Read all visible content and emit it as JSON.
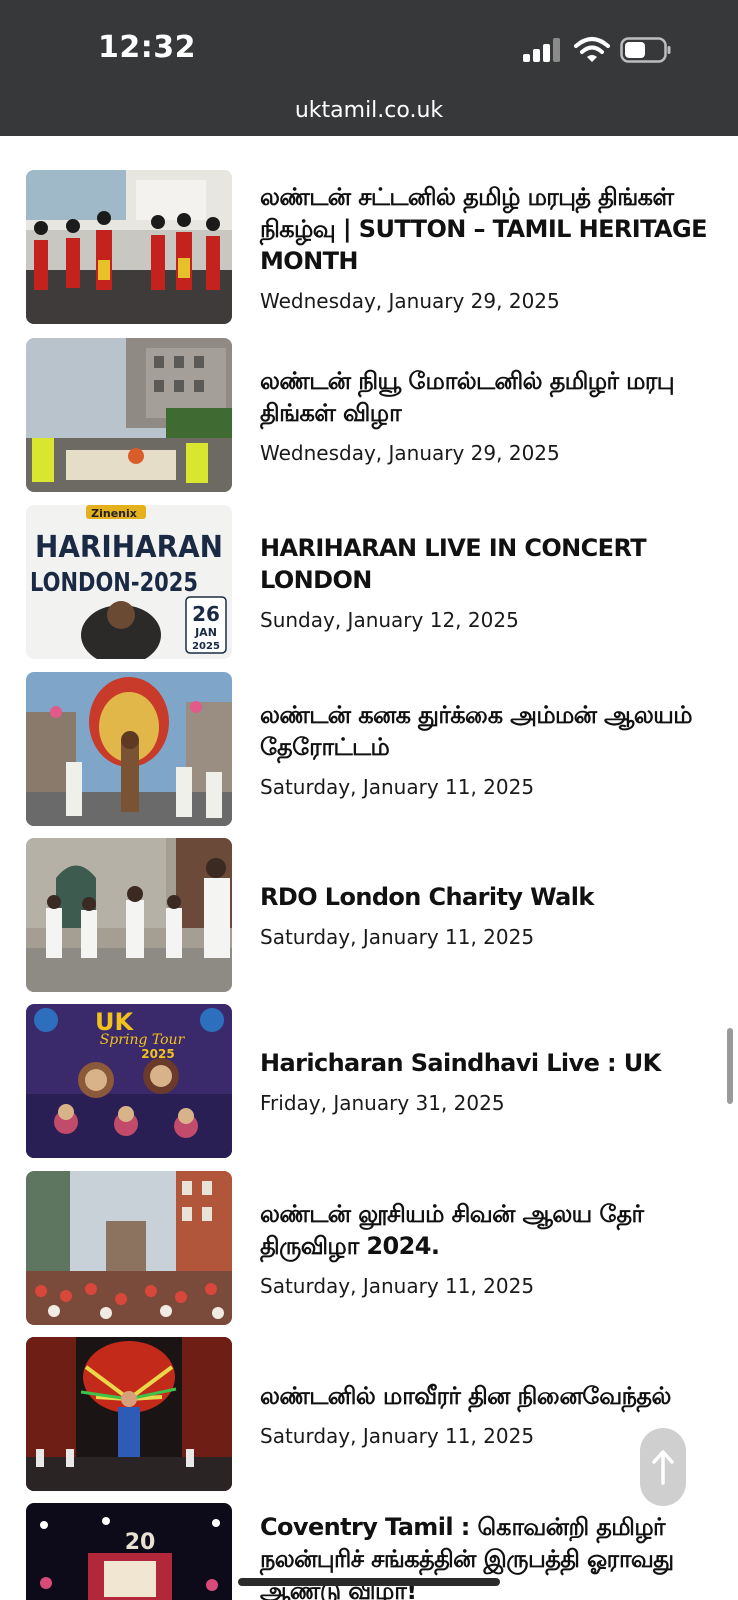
{
  "status_bar": {
    "time": "12:32",
    "url": "uktamil.co.uk",
    "icons": [
      "signal-icon",
      "wifi-icon",
      "battery-icon"
    ]
  },
  "articles": [
    {
      "title": "லண்டன் சட்டனில் தமிழ் மரபுத் திங்கள் நிகழ்வு | SUTTON – TAMIL HERITAGE MONTH",
      "date": "Wednesday, January 29, 2025"
    },
    {
      "title": "லண்டன் நியூ மோல்டனில் தமிழர் மரபு திங்கள் விழா",
      "date": "Wednesday, January 29, 2025"
    },
    {
      "title": "HARIHARAN LIVE IN CONCERT LONDON",
      "date": "Sunday, January 12, 2025",
      "thumb_text": {
        "brand": "Zinenix",
        "name": "HARIHARAN",
        "city": "LONDON-2025",
        "day": "26",
        "month": "JAN",
        "year": "2025"
      }
    },
    {
      "title": "லண்டன் கனக துர்க்கை அம்மன் ஆலயம் தேரோட்டம்",
      "date": "Saturday, January 11, 2025"
    },
    {
      "title": "RDO London Charity Walk",
      "date": "Saturday, January 11, 2025"
    },
    {
      "title": "Haricharan Saindhavi Live : UK",
      "date": "Friday, January 31, 2025",
      "thumb_text": {
        "line1": "UK",
        "line2": "Spring Tour",
        "year": "2025"
      }
    },
    {
      "title": "லண்டன் லூசியம் சிவன் ஆலய தேர் திருவிழா 2024.",
      "date": "Saturday, January 11, 2025"
    },
    {
      "title": "லண்டனில் மாவீரர் தின நினைவேந்தல்",
      "date": "Saturday, January 11, 2025"
    },
    {
      "title": "Coventry Tamil : கொவன்றி தமிழர் நலன்புரிச் சங்கத்தின் இருபத்தி ஓராவது ஆண்டு விழா!",
      "date": "",
      "thumb_text": {
        "badge": "20"
      }
    }
  ],
  "colors": {
    "status_bar_bg": "#363839",
    "title_text": "#111111",
    "back_to_top_bg": "#cfcfcf"
  }
}
